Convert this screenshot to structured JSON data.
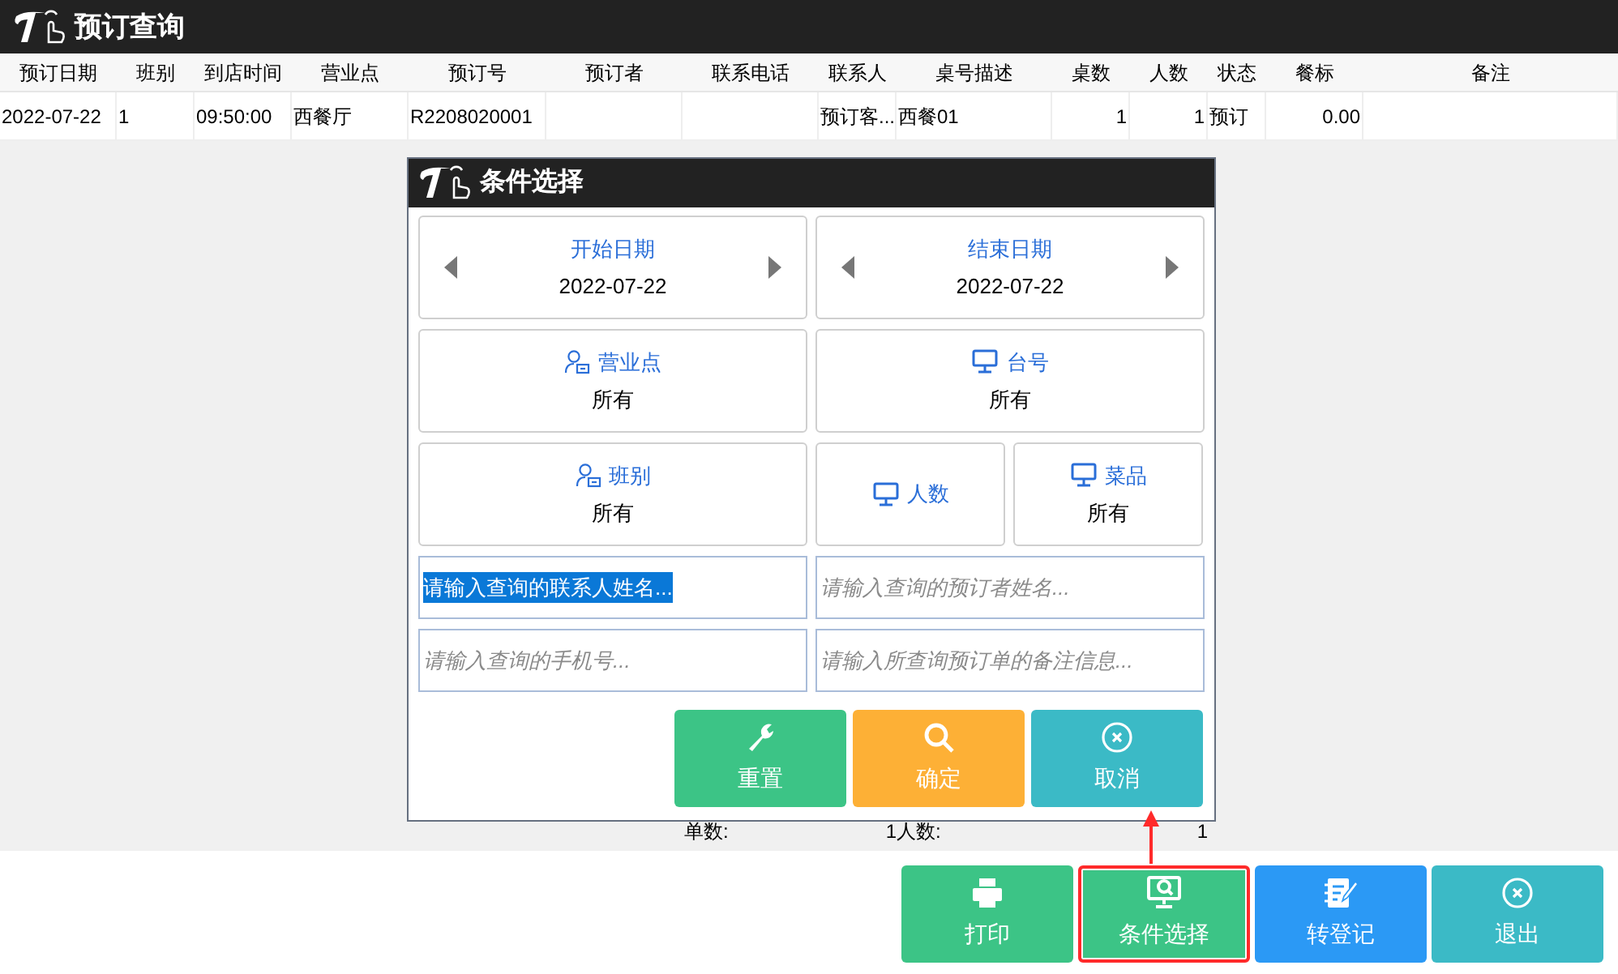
{
  "window": {
    "title": "预订查询"
  },
  "table": {
    "columns": [
      "预订日期",
      "班别",
      "到店时间",
      "营业点",
      "预订号",
      "预订者",
      "联系电话",
      "联系人",
      "桌号描述",
      "桌数",
      "人数",
      "状态",
      "餐标",
      "备注"
    ],
    "rows": [
      [
        "2022-07-22",
        "1",
        "09:50:00",
        "西餐厅",
        "R2208020001",
        "",
        "",
        "预订客...",
        "西餐01",
        "1",
        "1",
        "预订",
        "0.00",
        ""
      ]
    ]
  },
  "summary": [
    {
      "label": "单数:",
      "value": "1"
    },
    {
      "label": "人数:",
      "value": "1"
    }
  ],
  "dialog": {
    "title": "条件选择",
    "filters": [
      {
        "kind": "date",
        "label": "开始日期",
        "value": "2022-07-22"
      },
      {
        "kind": "date",
        "label": "结束日期",
        "value": "2022-07-22"
      },
      {
        "kind": "staff",
        "label": "营业点",
        "value": "所有"
      },
      {
        "kind": "table",
        "label": "台号",
        "value": "所有"
      },
      {
        "kind": "staff",
        "label": "班别",
        "value": "所有"
      },
      {
        "kind": "table",
        "label": "人数"
      },
      {
        "kind": "table",
        "label": "菜品",
        "value": "所有"
      }
    ],
    "fields": [
      {
        "placeholder": "请输入查询的联系人姓名...",
        "selected": true
      },
      {
        "placeholder": "请输入查询的预订者姓名...",
        "selected": false
      },
      {
        "placeholder": "请输入查询的手机号...",
        "selected": false
      },
      {
        "placeholder": "请输入所查询预订单的备注信息...",
        "selected": false
      }
    ],
    "buttons": [
      {
        "kind": "reset",
        "label": "重置",
        "color": "#3cc486"
      },
      {
        "kind": "confirm",
        "label": "确定",
        "color": "#fdb036"
      },
      {
        "kind": "cancel",
        "label": "取消",
        "color": "#3bbac6"
      }
    ]
  },
  "toolbar": [
    {
      "kind": "print",
      "label": "打印",
      "color": "#3cc486",
      "highlighted": false
    },
    {
      "kind": "filter",
      "label": "条件选择",
      "color": "#3cc486",
      "highlighted": true
    },
    {
      "kind": "register",
      "label": "转登记",
      "color": "#2b99f5",
      "highlighted": false
    },
    {
      "kind": "exit",
      "label": "退出",
      "color": "#3bbac6",
      "highlighted": false
    }
  ]
}
